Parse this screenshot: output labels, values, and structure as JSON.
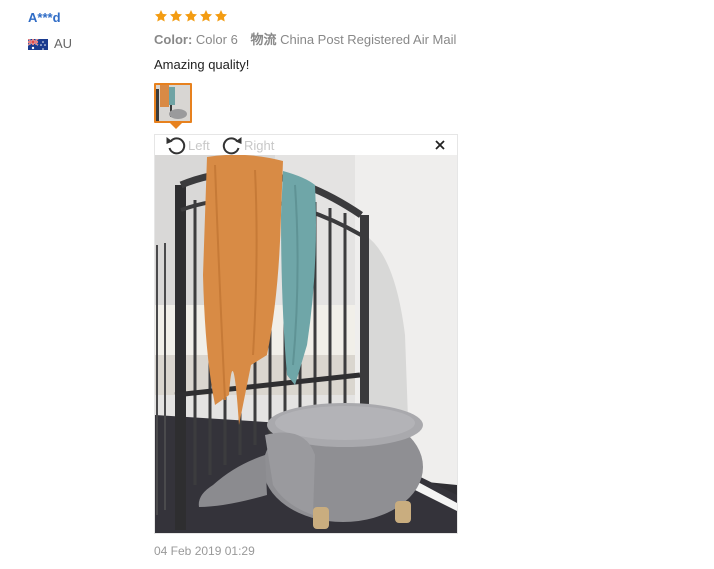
{
  "reviewer": {
    "name": "A***d",
    "country_code": "AU"
  },
  "rating": {
    "stars": 5,
    "max": 5,
    "color": "#f39c12"
  },
  "attributes": {
    "color_label": "Color:",
    "color_value": "Color 6",
    "shipping_label": "物流",
    "shipping_value": "China Post Registered Air Mail"
  },
  "review": {
    "text": "Amazing quality!"
  },
  "viewer": {
    "rotate_left_label": "Left",
    "rotate_right_label": "Right"
  },
  "date": "04 Feb 2019 01:29",
  "colors": {
    "accent": "#e7811e",
    "link": "#2f6cc6"
  }
}
